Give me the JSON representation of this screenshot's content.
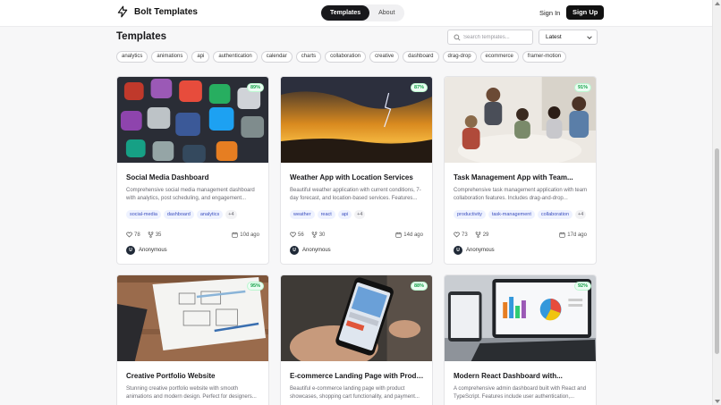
{
  "header": {
    "brand": "Bolt Templates",
    "icon": "bolt-icon",
    "nav": [
      {
        "label": "Templates",
        "active": true
      },
      {
        "label": "About",
        "active": false
      }
    ],
    "sign_in": "Sign In",
    "sign_up": "Sign Up"
  },
  "main": {
    "title": "Templates",
    "search_placeholder": "Search templates...",
    "sort_value": "Latest",
    "filter_tags": [
      "analytics",
      "animations",
      "api",
      "authentication",
      "calendar",
      "charts",
      "collaboration",
      "creative",
      "dashboard",
      "drag-drop",
      "ecommerce",
      "framer-motion"
    ]
  },
  "cards": [
    {
      "title": "Social Media Dashboard",
      "description": "Comprehensive social media management dashboard with analytics, post scheduling, and engagement...",
      "score": "89%",
      "tags": [
        "social-media",
        "dashboard",
        "analytics"
      ],
      "more": "+4",
      "likes": "78",
      "forks": "35",
      "date": "10d ago",
      "author": "Anonymous",
      "author_initial": "U"
    },
    {
      "title": "Weather App with Location Services",
      "description": "Beautiful weather application with current conditions, 7-day forecast, and location-based services. Features...",
      "score": "87%",
      "tags": [
        "weather",
        "react",
        "api"
      ],
      "more": "+4",
      "likes": "56",
      "forks": "30",
      "date": "14d ago",
      "author": "Anonymous",
      "author_initial": "U"
    },
    {
      "title": "Task Management App with Team...",
      "description": "Comprehensive task management application with team collaboration features. Includes drag-and-drop...",
      "score": "91%",
      "tags": [
        "productivity",
        "task-management",
        "collaboration"
      ],
      "more": "+4",
      "likes": "73",
      "forks": "29",
      "date": "17d ago",
      "author": "Anonymous",
      "author_initial": "U"
    },
    {
      "title": "Creative Portfolio Website",
      "description": "Stunning creative portfolio website with smooth animations and modern design. Perfect for designers...",
      "score": "95%"
    },
    {
      "title": "E-commerce Landing Page with Produc...",
      "description": "Beautiful e-commerce landing page with product showcases, shopping cart functionality, and payment...",
      "score": "88%"
    },
    {
      "title": "Modern React Dashboard with...",
      "description": "A comprehensive admin dashboard built with React and TypeScript. Features include user authentication,...",
      "score": "92%"
    }
  ]
}
